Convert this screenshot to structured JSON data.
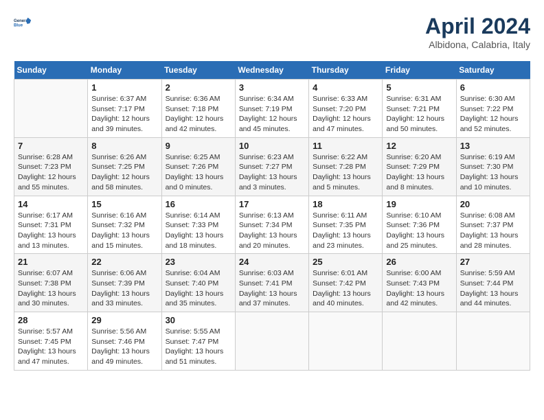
{
  "header": {
    "logo_line1": "General",
    "logo_line2": "Blue",
    "title": "April 2024",
    "location": "Albidona, Calabria, Italy"
  },
  "weekdays": [
    "Sunday",
    "Monday",
    "Tuesday",
    "Wednesday",
    "Thursday",
    "Friday",
    "Saturday"
  ],
  "weeks": [
    [
      {
        "day": "",
        "sunrise": "",
        "sunset": "",
        "daylight": ""
      },
      {
        "day": "1",
        "sunrise": "Sunrise: 6:37 AM",
        "sunset": "Sunset: 7:17 PM",
        "daylight": "Daylight: 12 hours and 39 minutes."
      },
      {
        "day": "2",
        "sunrise": "Sunrise: 6:36 AM",
        "sunset": "Sunset: 7:18 PM",
        "daylight": "Daylight: 12 hours and 42 minutes."
      },
      {
        "day": "3",
        "sunrise": "Sunrise: 6:34 AM",
        "sunset": "Sunset: 7:19 PM",
        "daylight": "Daylight: 12 hours and 45 minutes."
      },
      {
        "day": "4",
        "sunrise": "Sunrise: 6:33 AM",
        "sunset": "Sunset: 7:20 PM",
        "daylight": "Daylight: 12 hours and 47 minutes."
      },
      {
        "day": "5",
        "sunrise": "Sunrise: 6:31 AM",
        "sunset": "Sunset: 7:21 PM",
        "daylight": "Daylight: 12 hours and 50 minutes."
      },
      {
        "day": "6",
        "sunrise": "Sunrise: 6:30 AM",
        "sunset": "Sunset: 7:22 PM",
        "daylight": "Daylight: 12 hours and 52 minutes."
      }
    ],
    [
      {
        "day": "7",
        "sunrise": "Sunrise: 6:28 AM",
        "sunset": "Sunset: 7:23 PM",
        "daylight": "Daylight: 12 hours and 55 minutes."
      },
      {
        "day": "8",
        "sunrise": "Sunrise: 6:26 AM",
        "sunset": "Sunset: 7:25 PM",
        "daylight": "Daylight: 12 hours and 58 minutes."
      },
      {
        "day": "9",
        "sunrise": "Sunrise: 6:25 AM",
        "sunset": "Sunset: 7:26 PM",
        "daylight": "Daylight: 13 hours and 0 minutes."
      },
      {
        "day": "10",
        "sunrise": "Sunrise: 6:23 AM",
        "sunset": "Sunset: 7:27 PM",
        "daylight": "Daylight: 13 hours and 3 minutes."
      },
      {
        "day": "11",
        "sunrise": "Sunrise: 6:22 AM",
        "sunset": "Sunset: 7:28 PM",
        "daylight": "Daylight: 13 hours and 5 minutes."
      },
      {
        "day": "12",
        "sunrise": "Sunrise: 6:20 AM",
        "sunset": "Sunset: 7:29 PM",
        "daylight": "Daylight: 13 hours and 8 minutes."
      },
      {
        "day": "13",
        "sunrise": "Sunrise: 6:19 AM",
        "sunset": "Sunset: 7:30 PM",
        "daylight": "Daylight: 13 hours and 10 minutes."
      }
    ],
    [
      {
        "day": "14",
        "sunrise": "Sunrise: 6:17 AM",
        "sunset": "Sunset: 7:31 PM",
        "daylight": "Daylight: 13 hours and 13 minutes."
      },
      {
        "day": "15",
        "sunrise": "Sunrise: 6:16 AM",
        "sunset": "Sunset: 7:32 PM",
        "daylight": "Daylight: 13 hours and 15 minutes."
      },
      {
        "day": "16",
        "sunrise": "Sunrise: 6:14 AM",
        "sunset": "Sunset: 7:33 PM",
        "daylight": "Daylight: 13 hours and 18 minutes."
      },
      {
        "day": "17",
        "sunrise": "Sunrise: 6:13 AM",
        "sunset": "Sunset: 7:34 PM",
        "daylight": "Daylight: 13 hours and 20 minutes."
      },
      {
        "day": "18",
        "sunrise": "Sunrise: 6:11 AM",
        "sunset": "Sunset: 7:35 PM",
        "daylight": "Daylight: 13 hours and 23 minutes."
      },
      {
        "day": "19",
        "sunrise": "Sunrise: 6:10 AM",
        "sunset": "Sunset: 7:36 PM",
        "daylight": "Daylight: 13 hours and 25 minutes."
      },
      {
        "day": "20",
        "sunrise": "Sunrise: 6:08 AM",
        "sunset": "Sunset: 7:37 PM",
        "daylight": "Daylight: 13 hours and 28 minutes."
      }
    ],
    [
      {
        "day": "21",
        "sunrise": "Sunrise: 6:07 AM",
        "sunset": "Sunset: 7:38 PM",
        "daylight": "Daylight: 13 hours and 30 minutes."
      },
      {
        "day": "22",
        "sunrise": "Sunrise: 6:06 AM",
        "sunset": "Sunset: 7:39 PM",
        "daylight": "Daylight: 13 hours and 33 minutes."
      },
      {
        "day": "23",
        "sunrise": "Sunrise: 6:04 AM",
        "sunset": "Sunset: 7:40 PM",
        "daylight": "Daylight: 13 hours and 35 minutes."
      },
      {
        "day": "24",
        "sunrise": "Sunrise: 6:03 AM",
        "sunset": "Sunset: 7:41 PM",
        "daylight": "Daylight: 13 hours and 37 minutes."
      },
      {
        "day": "25",
        "sunrise": "Sunrise: 6:01 AM",
        "sunset": "Sunset: 7:42 PM",
        "daylight": "Daylight: 13 hours and 40 minutes."
      },
      {
        "day": "26",
        "sunrise": "Sunrise: 6:00 AM",
        "sunset": "Sunset: 7:43 PM",
        "daylight": "Daylight: 13 hours and 42 minutes."
      },
      {
        "day": "27",
        "sunrise": "Sunrise: 5:59 AM",
        "sunset": "Sunset: 7:44 PM",
        "daylight": "Daylight: 13 hours and 44 minutes."
      }
    ],
    [
      {
        "day": "28",
        "sunrise": "Sunrise: 5:57 AM",
        "sunset": "Sunset: 7:45 PM",
        "daylight": "Daylight: 13 hours and 47 minutes."
      },
      {
        "day": "29",
        "sunrise": "Sunrise: 5:56 AM",
        "sunset": "Sunset: 7:46 PM",
        "daylight": "Daylight: 13 hours and 49 minutes."
      },
      {
        "day": "30",
        "sunrise": "Sunrise: 5:55 AM",
        "sunset": "Sunset: 7:47 PM",
        "daylight": "Daylight: 13 hours and 51 minutes."
      },
      {
        "day": "",
        "sunrise": "",
        "sunset": "",
        "daylight": ""
      },
      {
        "day": "",
        "sunrise": "",
        "sunset": "",
        "daylight": ""
      },
      {
        "day": "",
        "sunrise": "",
        "sunset": "",
        "daylight": ""
      },
      {
        "day": "",
        "sunrise": "",
        "sunset": "",
        "daylight": ""
      }
    ]
  ]
}
